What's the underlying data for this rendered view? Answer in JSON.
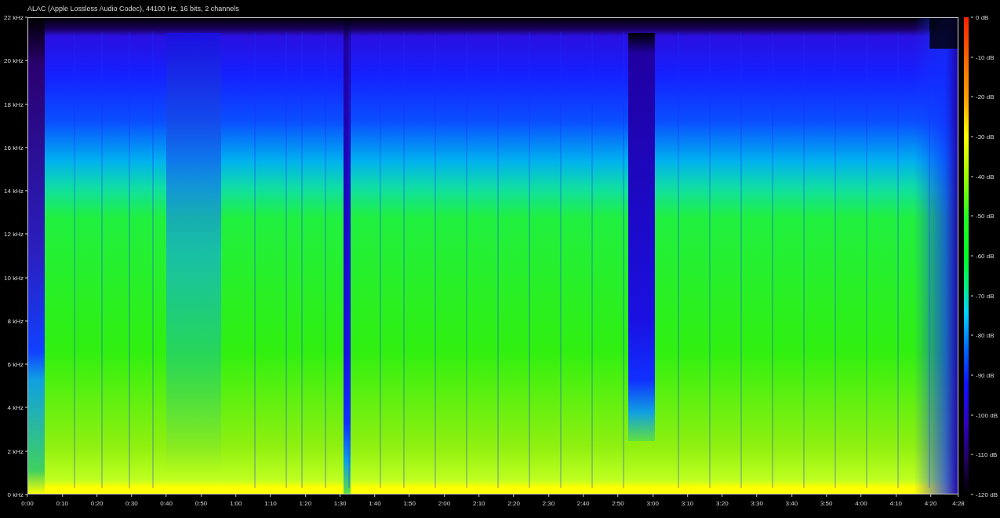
{
  "title": "ALAC (Apple Lossless Audio Codec), 44100 Hz, 16 bits, 2 channels",
  "frequency_axis": [
    "22 kHz",
    "20 kHz",
    "18 kHz",
    "16 kHz",
    "14 kHz",
    "12 kHz",
    "10 kHz",
    "8 kHz",
    "6 kHz",
    "4 kHz",
    "2 kHz",
    "0 kHz"
  ],
  "time_axis": [
    "0:00",
    "0:10",
    "0:20",
    "0:30",
    "0:40",
    "0:50",
    "1:00",
    "1:10",
    "1:20",
    "1:30",
    "1:40",
    "1:50",
    "2:00",
    "2:10",
    "2:20",
    "2:30",
    "2:40",
    "2:50",
    "3:00",
    "3:10",
    "3:20",
    "3:30",
    "3:40",
    "3:50",
    "4:00",
    "4:10",
    "4:20",
    "4:28"
  ],
  "level_scale": [
    "0 dB",
    "-10 dB",
    "-20 dB",
    "-30 dB",
    "-40 dB",
    "-50 dB",
    "-60 dB",
    "-70 dB",
    "-80 dB",
    "-90 dB",
    "-100 dB",
    "-110 dB",
    "-120 dB"
  ]
}
